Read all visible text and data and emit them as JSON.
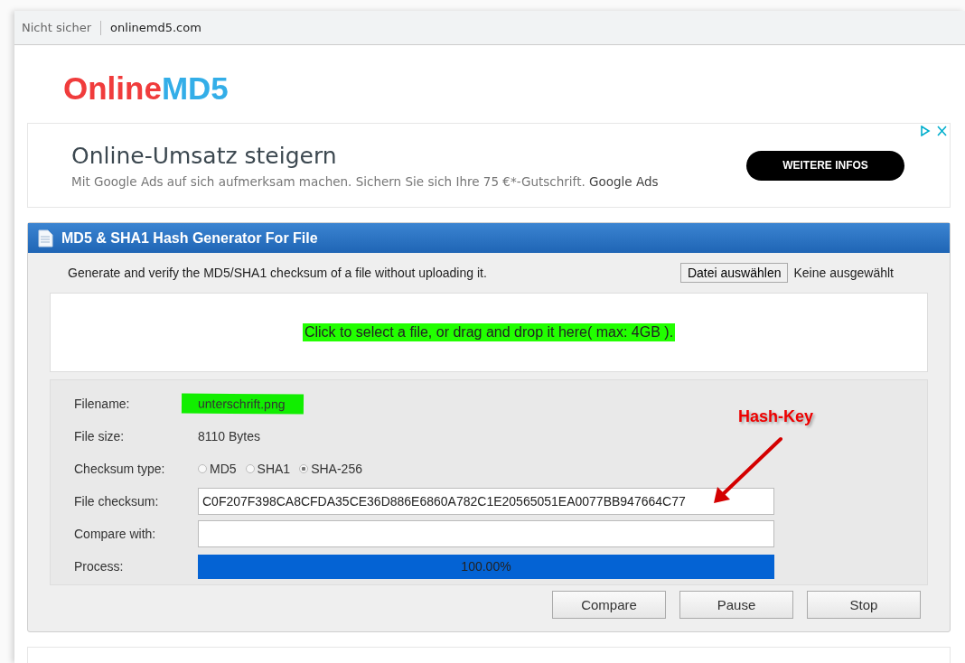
{
  "address_bar": {
    "security": "Nicht sicher",
    "url": "onlinemd5.com"
  },
  "logo": {
    "part_1": "Online",
    "part_2": "MD5"
  },
  "ad": {
    "headline": "Online-Umsatz steigern",
    "text": "Mit Google Ads auf sich aufmerksam machen. Sichern Sie sich Ihre 75 €*-Gutschrift.",
    "source": "Google Ads",
    "button": "WEITERE INFOS"
  },
  "panel": {
    "title": "MD5 & SHA1 Hash Generator For File",
    "intro": "Generate and verify the MD5/SHA1 checksum of a file without uploading it.",
    "file_button": "Datei auswählen",
    "file_status": "Keine ausgewählt",
    "drop_zone": "Click to select a file, or drag and drop it here( max: 4GB ).",
    "fields": [
      {
        "label": "Filename:",
        "value": "unterschrift.png"
      },
      {
        "label": "File size:",
        "value": "8110 Bytes"
      }
    ],
    "checksum_type": {
      "label": "Checksum type:",
      "options": [
        {
          "label": "MD5",
          "selected": false
        },
        {
          "label": "SHA1",
          "selected": false
        },
        {
          "label": "SHA-256",
          "selected": true
        }
      ]
    },
    "file_checksum": {
      "label": "File checksum:",
      "value": "C0F207F398CA8CFDA35CE36D886E6860A782C1E20565051EA0077BB947664C77"
    },
    "compare_with": {
      "label": "Compare with:"
    },
    "process": {
      "label": "Process:",
      "level": 1,
      "reading": "100.00%"
    },
    "buttons": [
      "Compare",
      "Pause",
      "Stop"
    ]
  },
  "annotation": {
    "text": "Hash-Key"
  }
}
